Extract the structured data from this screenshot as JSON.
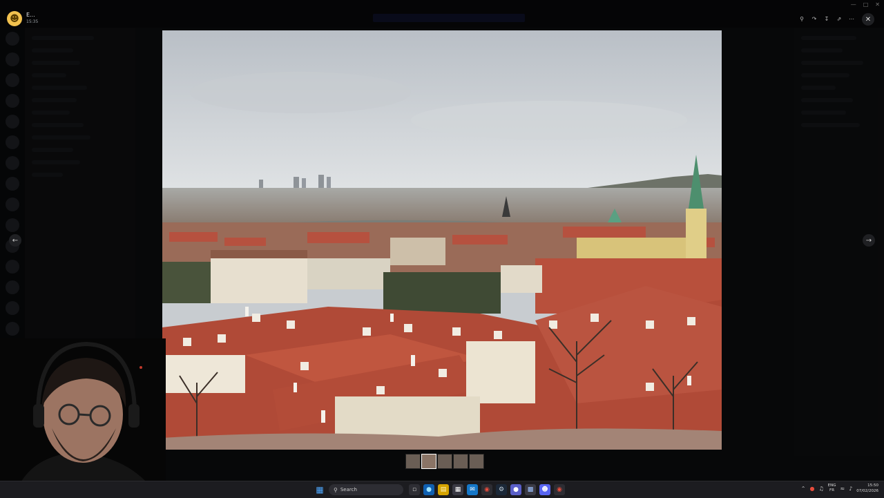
{
  "viewer": {
    "uploader_name": "E...",
    "uploader_sub": "15:35",
    "nav_prev_icon": "arrow-left-icon",
    "nav_next_icon": "arrow-right-icon",
    "close_icon": "close-icon",
    "thumbnail_count": 5,
    "active_thumbnail": 2
  },
  "taskbar": {
    "search_label": "Search",
    "lang_top": "ENG",
    "lang_bottom": "FR",
    "time": "15:50",
    "date": "07/02/2026"
  }
}
